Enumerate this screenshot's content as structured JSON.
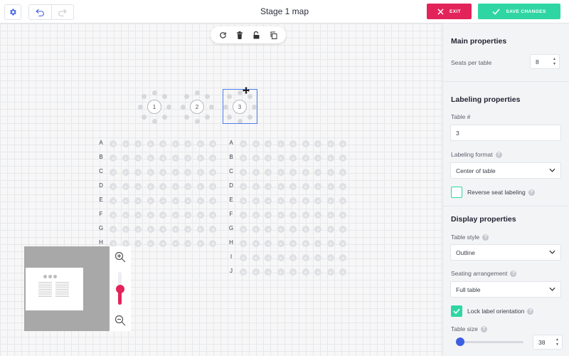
{
  "header": {
    "title": "Stage 1 map",
    "exit_label": "EXIT",
    "save_label": "SAVE CHANGES",
    "exit_color": "#e2245a",
    "save_color": "#2fd6a3"
  },
  "toolbar": {
    "icons": [
      "rotate-icon",
      "trash-icon",
      "unlock-icon",
      "copy-icon"
    ]
  },
  "canvas": {
    "round_tables": [
      {
        "label": "1",
        "selected": false
      },
      {
        "label": "2",
        "selected": false
      },
      {
        "label": "3",
        "selected": true
      }
    ],
    "left_block_rows": [
      "A",
      "B",
      "C",
      "D",
      "E",
      "F",
      "G",
      "H"
    ],
    "right_block_rows": [
      "A",
      "B",
      "C",
      "D",
      "E",
      "F",
      "G",
      "H",
      "I",
      "J"
    ],
    "seats_per_row": 9
  },
  "panel": {
    "main": {
      "title": "Main properties",
      "seats_label": "Seats per table",
      "seats_value": "8"
    },
    "labeling": {
      "title": "Labeling properties",
      "table_label": "Table #",
      "table_value": "3",
      "format_label": "Labeling format",
      "format_value": "Center of table",
      "reverse_label": "Reverse seat labeling",
      "reverse_checked": false
    },
    "display": {
      "title": "Display properties",
      "style_label": "Table style",
      "style_value": "Outline",
      "arrangement_label": "Seating arrangement",
      "arrangement_value": "Full table",
      "lock_label": "Lock label orientation",
      "lock_checked": true,
      "size_label": "Table size",
      "size_value": "38"
    }
  },
  "colors": {
    "accent_pink": "#e2245a",
    "accent_green": "#2fd6a3",
    "accent_blue": "#3b5fe0"
  }
}
